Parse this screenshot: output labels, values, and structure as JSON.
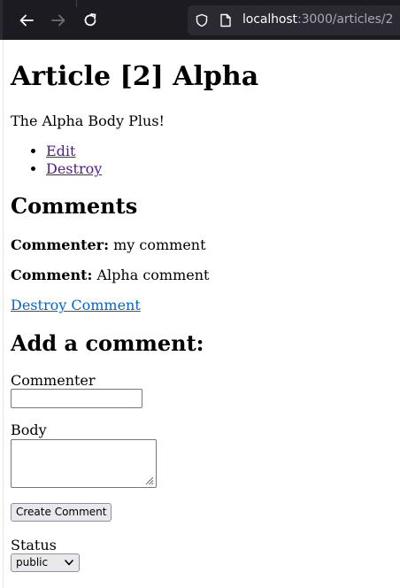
{
  "browser": {
    "url_host": "localhost",
    "url_rest": ":3000/articles/2",
    "icons": [
      "back-arrow-icon",
      "forward-arrow-icon",
      "reload-icon",
      "shield-icon",
      "page-icon"
    ]
  },
  "article": {
    "title": "Article [2] Alpha",
    "body": "The Alpha Body Plus!",
    "links": {
      "edit": "Edit",
      "destroy": "Destroy"
    }
  },
  "comments": {
    "heading": "Comments",
    "items": [
      {
        "commenter_label": "Commenter:",
        "commenter": "my comment",
        "comment_label": "Comment:",
        "body": "Alpha comment",
        "destroy_label": "Destroy Comment"
      }
    ]
  },
  "form": {
    "heading": "Add a comment:",
    "commenter_label": "Commenter",
    "commenter_value": "",
    "body_label": "Body",
    "body_value": "",
    "submit_label": "Create Comment",
    "status_label": "Status",
    "status_selected": "public"
  },
  "colors": {
    "toolbar_bg": "#1c1b22",
    "urlbar_bg": "#2b2a33",
    "visited_link": "#551a8b",
    "link": "#0066cc"
  }
}
